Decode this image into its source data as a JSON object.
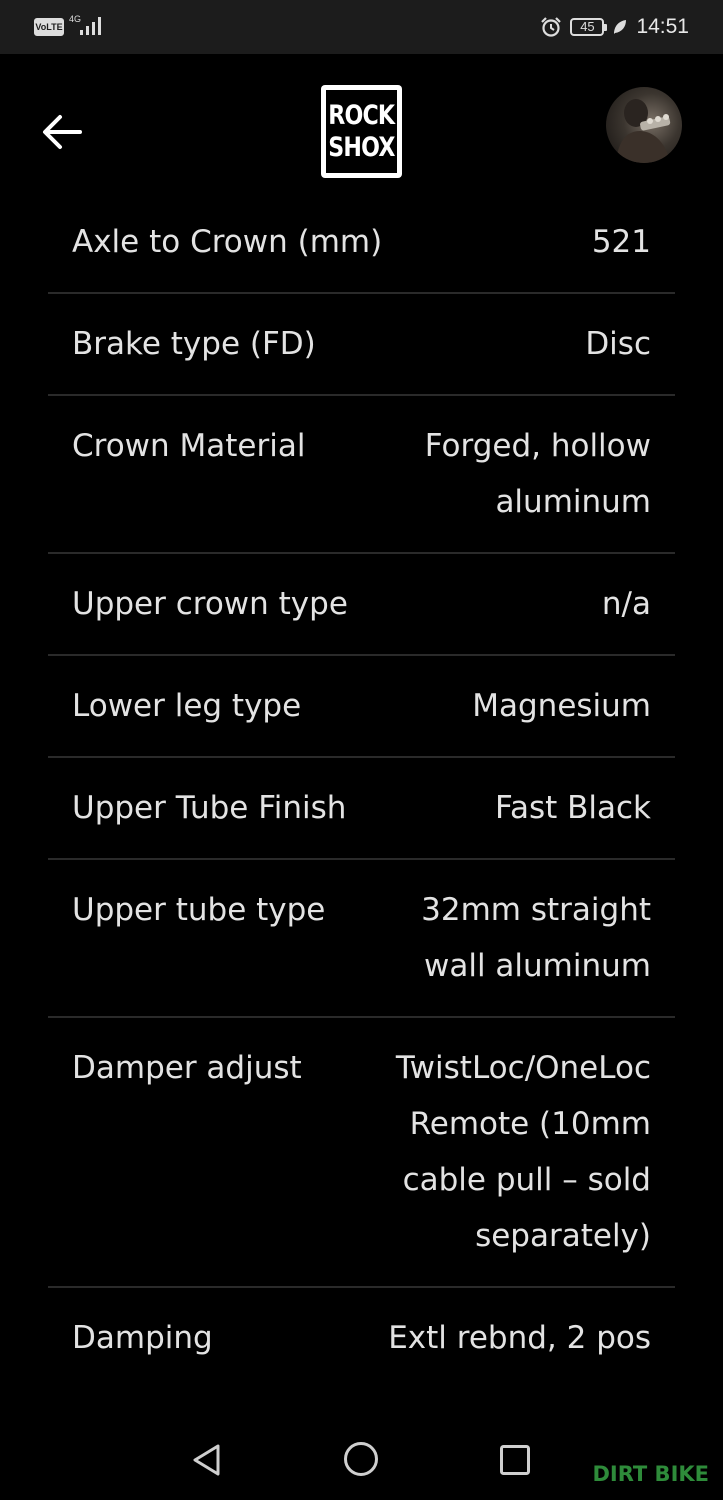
{
  "status_bar": {
    "volte": "VoLTE",
    "network": "4G",
    "battery": "45",
    "time": "14:51",
    "icons": [
      "signal-icon",
      "alarm-icon",
      "battery-icon",
      "leaf-icon"
    ]
  },
  "header": {
    "back_icon": "arrow-left-icon",
    "logo_line1": "ROCK",
    "logo_line2": "SHOX",
    "avatar": "profile-avatar"
  },
  "specs": [
    {
      "label": "Axle to Crown (mm)",
      "value": "521"
    },
    {
      "label": "Brake type (FD)",
      "value": "Disc"
    },
    {
      "label": "Crown Material",
      "value": "Forged, hollow aluminum"
    },
    {
      "label": "Upper crown type",
      "value": "n/a"
    },
    {
      "label": "Lower leg type",
      "value": "Magnesium"
    },
    {
      "label": "Upper Tube Finish",
      "value": "Fast Black"
    },
    {
      "label": "Upper tube type",
      "value": "32mm straight wall aluminum"
    },
    {
      "label": "Damper adjust",
      "value": "TwistLoc/OneLoc Remote (10mm cable pull – sold separately)"
    },
    {
      "label": "Damping",
      "value": "Extl rebnd, 2 pos"
    }
  ],
  "nav_bar": {
    "icons": [
      "triangle-back-icon",
      "circle-home-icon",
      "square-recents-icon"
    ]
  },
  "watermark": "DIRT BIKE",
  "colors": {
    "background": "#000000",
    "status_bar": "#1c1c1c",
    "text": "#e3e3e3",
    "divider": "#2a2a2a",
    "watermark": "#2e8b3a"
  }
}
